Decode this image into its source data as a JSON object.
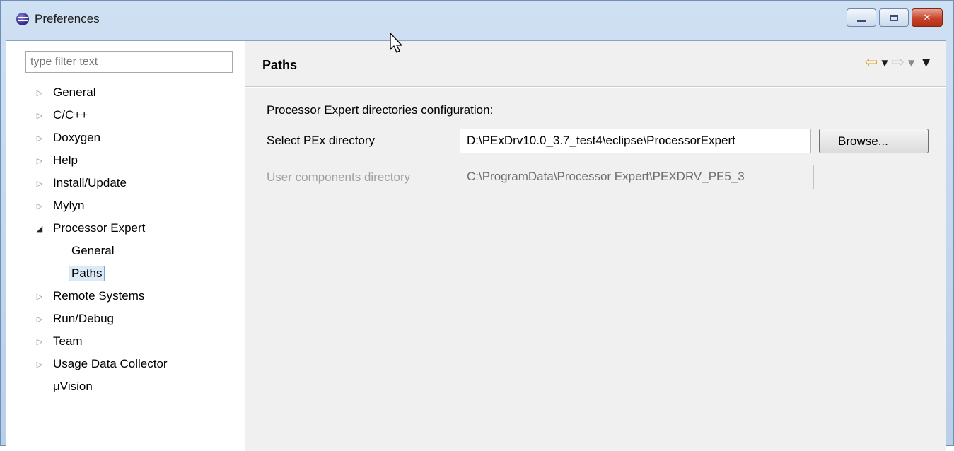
{
  "window": {
    "title": "Preferences",
    "controls": [
      "minimize",
      "maximize",
      "close"
    ]
  },
  "sidebar": {
    "filter_placeholder": "type filter text",
    "tree": [
      {
        "label": "General",
        "expandable": true,
        "expanded": false,
        "level": 0
      },
      {
        "label": "C/C++",
        "expandable": true,
        "expanded": false,
        "level": 0
      },
      {
        "label": "Doxygen",
        "expandable": true,
        "expanded": false,
        "level": 0
      },
      {
        "label": "Help",
        "expandable": true,
        "expanded": false,
        "level": 0
      },
      {
        "label": "Install/Update",
        "expandable": true,
        "expanded": false,
        "level": 0
      },
      {
        "label": "Mylyn",
        "expandable": true,
        "expanded": false,
        "level": 0
      },
      {
        "label": "Processor Expert",
        "expandable": true,
        "expanded": true,
        "level": 0
      },
      {
        "label": "General",
        "expandable": false,
        "level": 1
      },
      {
        "label": "Paths",
        "expandable": false,
        "level": 1,
        "selected": true
      },
      {
        "label": "Remote Systems",
        "expandable": true,
        "expanded": false,
        "level": 0
      },
      {
        "label": "Run/Debug",
        "expandable": true,
        "expanded": false,
        "level": 0
      },
      {
        "label": "Team",
        "expandable": true,
        "expanded": false,
        "level": 0
      },
      {
        "label": "Usage Data Collector",
        "expandable": true,
        "expanded": false,
        "level": 0
      },
      {
        "label": "μVision",
        "expandable": false,
        "level": 0
      }
    ]
  },
  "page": {
    "title": "Paths",
    "section_label": "Processor Expert directories configuration:",
    "pex_label": "Select PEx directory",
    "pex_value": "D:\\PExDrv10.0_3.7_test4\\eclipse\\ProcessorExpert",
    "browse_mnemonic": "B",
    "browse_rest": "rowse...",
    "user_label": "User components directory",
    "user_value": "C:\\ProgramData\\Processor Expert\\PEXDRV_PE5_3"
  },
  "colors": {
    "titlebar": "#cfe0f3",
    "back_arrow": "#e0a42a",
    "selection": "#dceaf8",
    "close_button": "#c7432a"
  },
  "icons": [
    "app-icon",
    "back-arrow-icon",
    "forward-arrow-icon",
    "view-menu-icon",
    "mouse-cursor-icon"
  ]
}
